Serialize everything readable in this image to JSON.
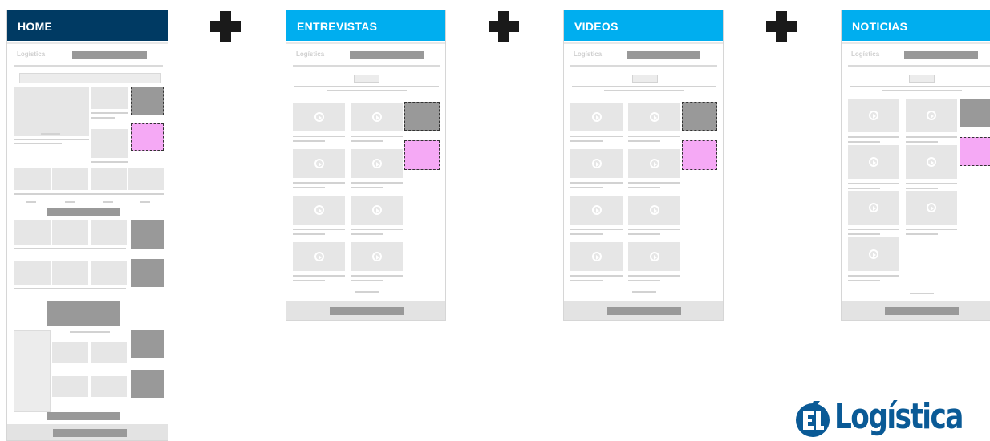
{
  "colors": {
    "home_header": "#003a63",
    "section_header": "#00aeef",
    "ad_gray": "#999999",
    "ad_pink": "#f5a9f5",
    "logo_blue": "#0a5a96"
  },
  "pages": [
    {
      "id": "home",
      "label": "HOME"
    },
    {
      "id": "entrevistas",
      "label": "ENTREVISTAS"
    },
    {
      "id": "videos",
      "label": "VIDEOS"
    },
    {
      "id": "noticias",
      "label": "NOTICIAS"
    }
  ],
  "mini_logo": "Logística",
  "brand_logo": {
    "text": "Logística",
    "icon": "el-monogram-icon"
  },
  "connector_icon": "plus-icon"
}
